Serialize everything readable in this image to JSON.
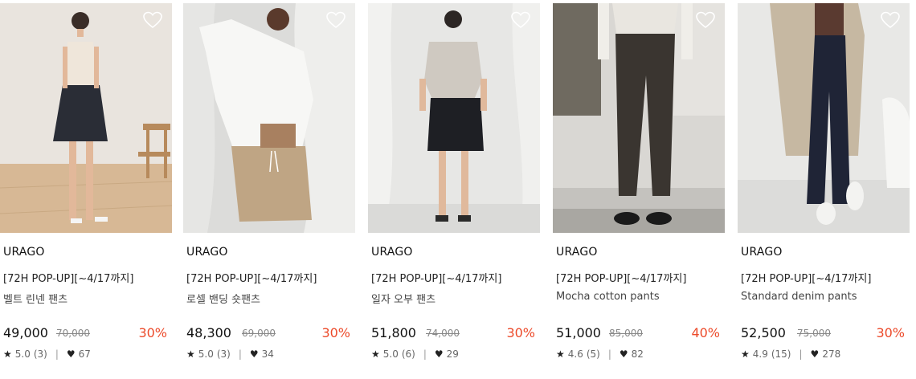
{
  "products": [
    {
      "brand": "URAGO",
      "promo": "[72H POP-UP][~4/17까지]",
      "name": "벨트 린넨 팬츠",
      "price": "49,000",
      "original_price": "70,000",
      "discount": "30%",
      "rating": "5.0",
      "reviews": "(3)",
      "likes": "67",
      "icon_rating": "star-icon",
      "icon_like": "heart-icon"
    },
    {
      "brand": "URAGO",
      "promo": "[72H POP-UP][~4/17까지]",
      "name": "로셀 밴딩 숏팬츠",
      "price": "48,300",
      "original_price": "69,000",
      "discount": "30%",
      "rating": "5.0",
      "reviews": "(3)",
      "likes": "34",
      "icon_rating": "star-icon",
      "icon_like": "heart-icon"
    },
    {
      "brand": "URAGO",
      "promo": "[72H POP-UP][~4/17까지]",
      "name": "일자 오부 팬츠",
      "price": "51,800",
      "original_price": "74,000",
      "discount": "30%",
      "rating": "5.0",
      "reviews": "(6)",
      "likes": "29",
      "icon_rating": "star-icon",
      "icon_like": "heart-icon"
    },
    {
      "brand": "URAGO",
      "promo": "[72H POP-UP][~4/17까지]",
      "name": "Mocha cotton pants",
      "price": "51,000",
      "original_price": "85,000",
      "discount": "40%",
      "rating": "4.6",
      "reviews": "(5)",
      "likes": "82",
      "icon_rating": "star-icon",
      "icon_like": "heart-icon"
    },
    {
      "brand": "URAGO",
      "promo": "[72H POP-UP][~4/17까지]",
      "name": "Standard denim pants",
      "price": "52,500",
      "original_price": "75,000",
      "discount": "30%",
      "rating": "4.9",
      "reviews": "(15)",
      "likes": "278",
      "icon_rating": "star-icon",
      "icon_like": "heart-icon"
    }
  ],
  "colors": {
    "discount": "#ec4a2a",
    "text": "#222222",
    "muted": "#888888"
  }
}
